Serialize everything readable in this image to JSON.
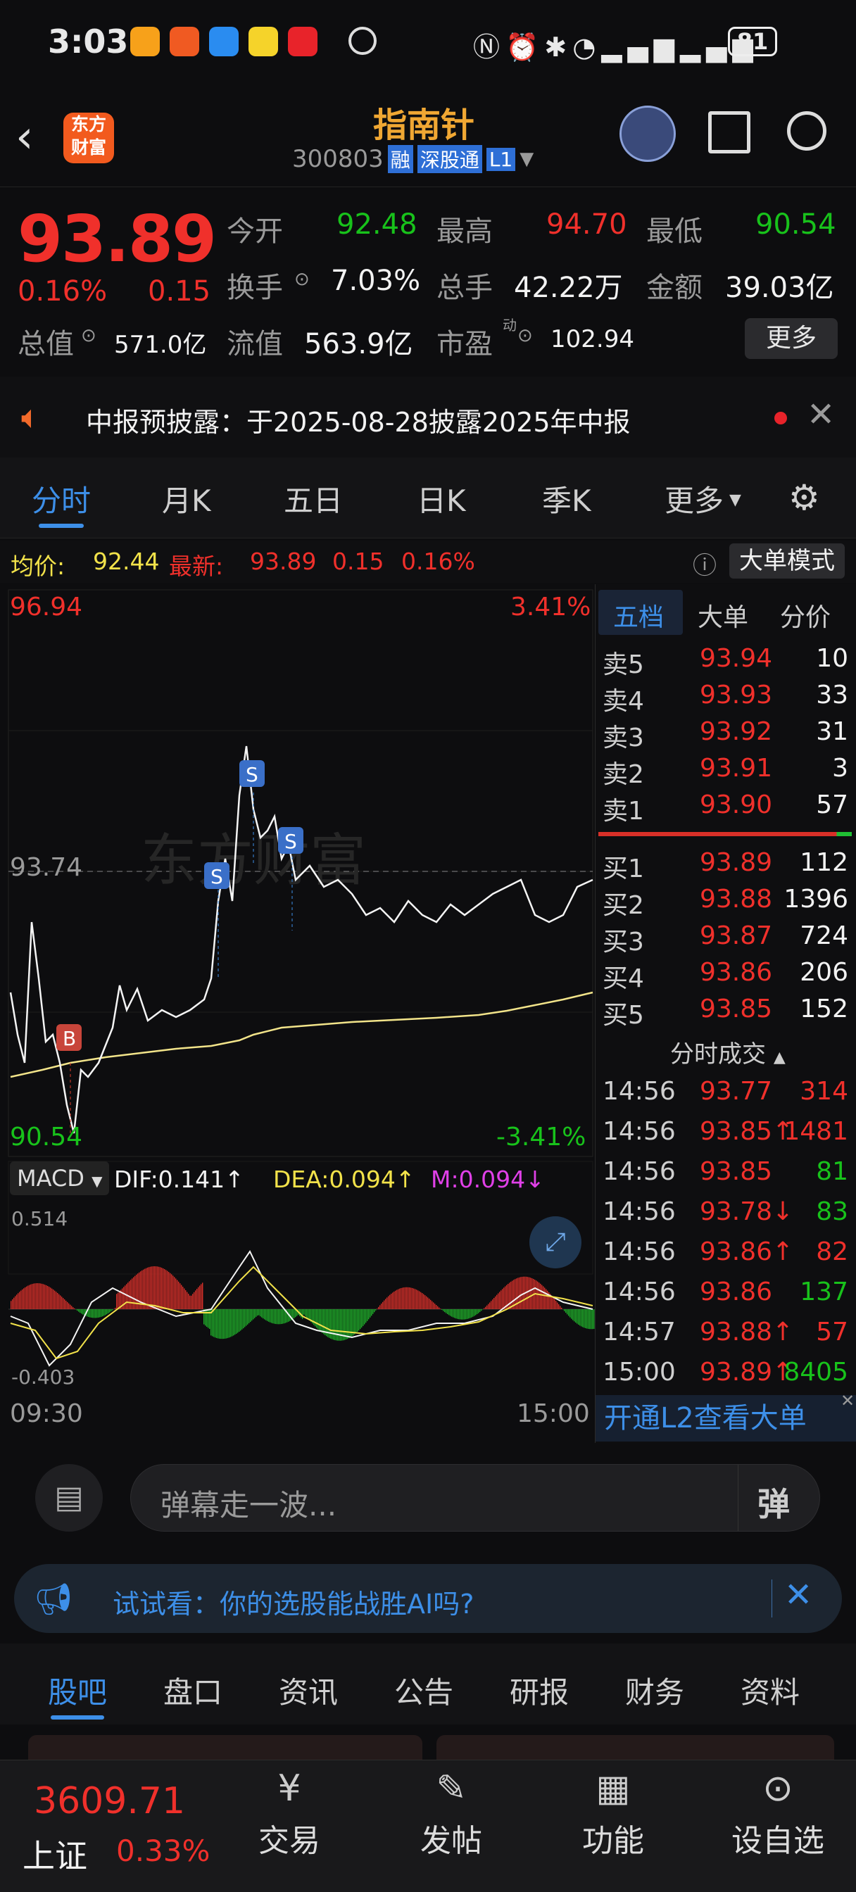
{
  "status": {
    "time": "3:03",
    "battery": "81"
  },
  "header": {
    "logo_line1": "东方",
    "logo_line2": "财富",
    "title": "指南针",
    "code": "300803",
    "badge_rong": "融",
    "badge_sgt": "深股通",
    "badge_l1": "L1"
  },
  "quote": {
    "price": "93.89",
    "change_pct": "0.16%",
    "change": "0.15",
    "open_label": "今开",
    "open": "92.48",
    "high_label": "最高",
    "high": "94.70",
    "low_label": "最低",
    "low": "90.54",
    "turnover_label": "换手",
    "turnover": "7.03%",
    "volume_label": "总手",
    "volume": "42.22万",
    "amount_label": "金额",
    "amount": "39.03亿",
    "mktcap_label": "总值",
    "mktcap": "571.0亿",
    "float_label": "流值",
    "float_cap": "563.9亿",
    "pe_label": "市盈",
    "pe_sup": "动",
    "pe": "102.94",
    "more": "更多"
  },
  "notice": {
    "text": "中报预披露：于2025-08-28披露2025年中报"
  },
  "ktabs": [
    "分时",
    "月K",
    "五日",
    "日K",
    "季K",
    "更多"
  ],
  "avgbar": {
    "avg_label": "均价:",
    "avg": "92.44",
    "last_label": "最新:",
    "last": "93.89",
    "chg": "0.15",
    "pct": "0.16%",
    "bigmode": "大单模式"
  },
  "chart": {
    "high": "96.94",
    "high_pct": "3.41%",
    "mid": "93.74",
    "low": "90.54",
    "low_pct": "-3.41%",
    "watermark": "东方财富",
    "macd_label": "MACD",
    "dif": "DIF:0.141↑",
    "dea": "DEA:0.094↑",
    "m": "M:0.094↓",
    "macd_top": "0.514",
    "macd_bot": "-0.403",
    "t_start": "09:30",
    "t_end": "15:00",
    "b_mark": "B",
    "s_mark": "S"
  },
  "book": {
    "tabs": [
      "五档",
      "大单",
      "分价"
    ],
    "asks": [
      {
        "l": "卖5",
        "p": "93.94",
        "v": "10"
      },
      {
        "l": "卖4",
        "p": "93.93",
        "v": "33"
      },
      {
        "l": "卖3",
        "p": "93.92",
        "v": "31"
      },
      {
        "l": "卖2",
        "p": "93.91",
        "v": "3"
      },
      {
        "l": "卖1",
        "p": "93.90",
        "v": "57"
      }
    ],
    "bids": [
      {
        "l": "买1",
        "p": "93.89",
        "v": "112"
      },
      {
        "l": "买2",
        "p": "93.88",
        "v": "1396"
      },
      {
        "l": "买3",
        "p": "93.87",
        "v": "724"
      },
      {
        "l": "买4",
        "p": "93.86",
        "v": "206"
      },
      {
        "l": "买5",
        "p": "93.85",
        "v": "152"
      }
    ],
    "ticks_title": "分时成交",
    "ticks": [
      {
        "t": "14:56",
        "p": "93.77",
        "v": "314",
        "vc": "red"
      },
      {
        "t": "14:56",
        "p": "93.85↑",
        "v": "1481",
        "vc": "red"
      },
      {
        "t": "14:56",
        "p": "93.85",
        "v": "81",
        "vc": "green"
      },
      {
        "t": "14:56",
        "p": "93.78↓",
        "v": "83",
        "vc": "green"
      },
      {
        "t": "14:56",
        "p": "93.86↑",
        "v": "82",
        "vc": "red"
      },
      {
        "t": "14:56",
        "p": "93.86",
        "v": "137",
        "vc": "green"
      },
      {
        "t": "14:57",
        "p": "93.88↑",
        "v": "57",
        "vc": "red"
      },
      {
        "t": "15:00",
        "p": "93.89↑",
        "v": "8405",
        "vc": "green"
      }
    ],
    "l2": "开通L2查看大单"
  },
  "danmu": {
    "placeholder": "弹幕走一波...",
    "btn": "弹"
  },
  "aiad": {
    "text": "试试看：你的选股能战胜AI吗?"
  },
  "btabs": [
    "股吧",
    "盘口",
    "资讯",
    "公告",
    "研报",
    "财务",
    "资料"
  ],
  "bottom": {
    "index": "3609.71",
    "index_name": "上证",
    "index_pct": "0.33%",
    "trade": "交易",
    "post": "发帖",
    "func": "功能",
    "watch": "设自选"
  }
}
